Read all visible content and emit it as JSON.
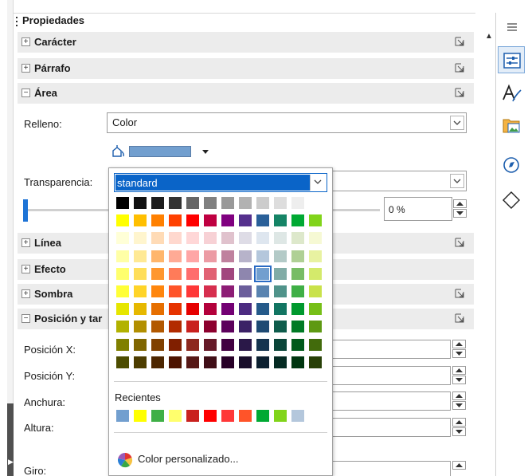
{
  "deck": {
    "title": "Propiedades",
    "sections": {
      "caracter": "Carácter",
      "parrafo": "Párrafo",
      "area": "Área",
      "linea": "Línea",
      "efecto": "Efecto",
      "sombra": "Sombra",
      "posicion": "Posición y tar"
    }
  },
  "area": {
    "fill_label": "Relleno:",
    "fill_value": "Color",
    "fill_color": "#729fcf",
    "transparency_label": "Transparencia:",
    "transparency_value": "0 %",
    "transparency_level_percent": 0
  },
  "position": {
    "x_label": "Posición X:",
    "y_label": "Posición Y:",
    "width_label": "Anchura:",
    "height_label": "Altura:",
    "rotation_label": "Giro:"
  },
  "color_popup": {
    "palette_name": "standard",
    "recent_label": "Recientes",
    "custom_label": "Color personalizado...",
    "selected_color": "#729fcf",
    "palette_rows": [
      [
        "#000000",
        "#111111",
        "#1c1c1c",
        "#333333",
        "#666666",
        "#808080",
        "#999999",
        "#b2b2b2",
        "#cccccc",
        "#dddddd",
        "#eeeeee",
        "#ffffff"
      ],
      [
        "#ffff00",
        "#ffbf00",
        "#ff8000",
        "#ff4000",
        "#ff0000",
        "#bf0041",
        "#800080",
        "#55308d",
        "#2a6099",
        "#158466",
        "#00a933",
        "#81d41a"
      ],
      [
        "#ffffd7",
        "#fff5ce",
        "#ffdbb6",
        "#ffd8ce",
        "#ffd7d7",
        "#f7d1d5",
        "#e0c2cd",
        "#dedce6",
        "#dee6ef",
        "#dee7e5",
        "#dde8cb",
        "#f6f9d4"
      ],
      [
        "#ffffa6",
        "#ffe994",
        "#ffb66c",
        "#ffaa95",
        "#ffa6a6",
        "#ec9ba4",
        "#bf819e",
        "#b7b3ca",
        "#b4c7dc",
        "#b3cac7",
        "#afd095",
        "#e8f2a1"
      ],
      [
        "#ffff6d",
        "#ffde59",
        "#ff972f",
        "#ff7b59",
        "#ff6d6d",
        "#e16173",
        "#a1467e",
        "#8e86ae",
        "#729fcf",
        "#81aca6",
        "#77bc65",
        "#d4ea6b"
      ],
      [
        "#ffff38",
        "#ffd428",
        "#ff860d",
        "#ff5429",
        "#ff3838",
        "#d62e4e",
        "#8d1d75",
        "#6b5e9b",
        "#5983b0",
        "#50938a",
        "#3faf46",
        "#c9e24a"
      ],
      [
        "#e6e600",
        "#e6b800",
        "#e66f00",
        "#e63300",
        "#e60000",
        "#b3003b",
        "#730073",
        "#4c2b81",
        "#255a8a",
        "#127562",
        "#00992e",
        "#76bf17"
      ],
      [
        "#b2b200",
        "#b28f00",
        "#b25800",
        "#b22b00",
        "#c9211e",
        "#8c002e",
        "#5c005c",
        "#3b2166",
        "#1e4a73",
        "#0e5c4c",
        "#007a25",
        "#5e9912"
      ],
      [
        "#808000",
        "#806600",
        "#804000",
        "#801f00",
        "#8d281e",
        "#661a28",
        "#420042",
        "#2a1848",
        "#15344f",
        "#0a4539",
        "#005a1b",
        "#426b0c"
      ],
      [
        "#4d4d00",
        "#4d3d00",
        "#4d2600",
        "#4d1300",
        "#571816",
        "#400e17",
        "#280028",
        "#190e2b",
        "#0c2030",
        "#052b23",
        "#003610",
        "#284007"
      ]
    ],
    "recent_colors": [
      "#729fcf",
      "#ffff00",
      "#3faf46",
      "#ffff6d",
      "#c9211e",
      "#ff0000",
      "#ff3838",
      "#ff5429",
      "#00a933",
      "#81d41a",
      "#b4c7dc"
    ]
  },
  "icons": {
    "menu": "hamburger-icon",
    "properties": "properties-icon",
    "styles": "styles-icon",
    "gallery": "gallery-icon",
    "navigator": "navigator-icon",
    "shapes": "shapes-icon"
  }
}
